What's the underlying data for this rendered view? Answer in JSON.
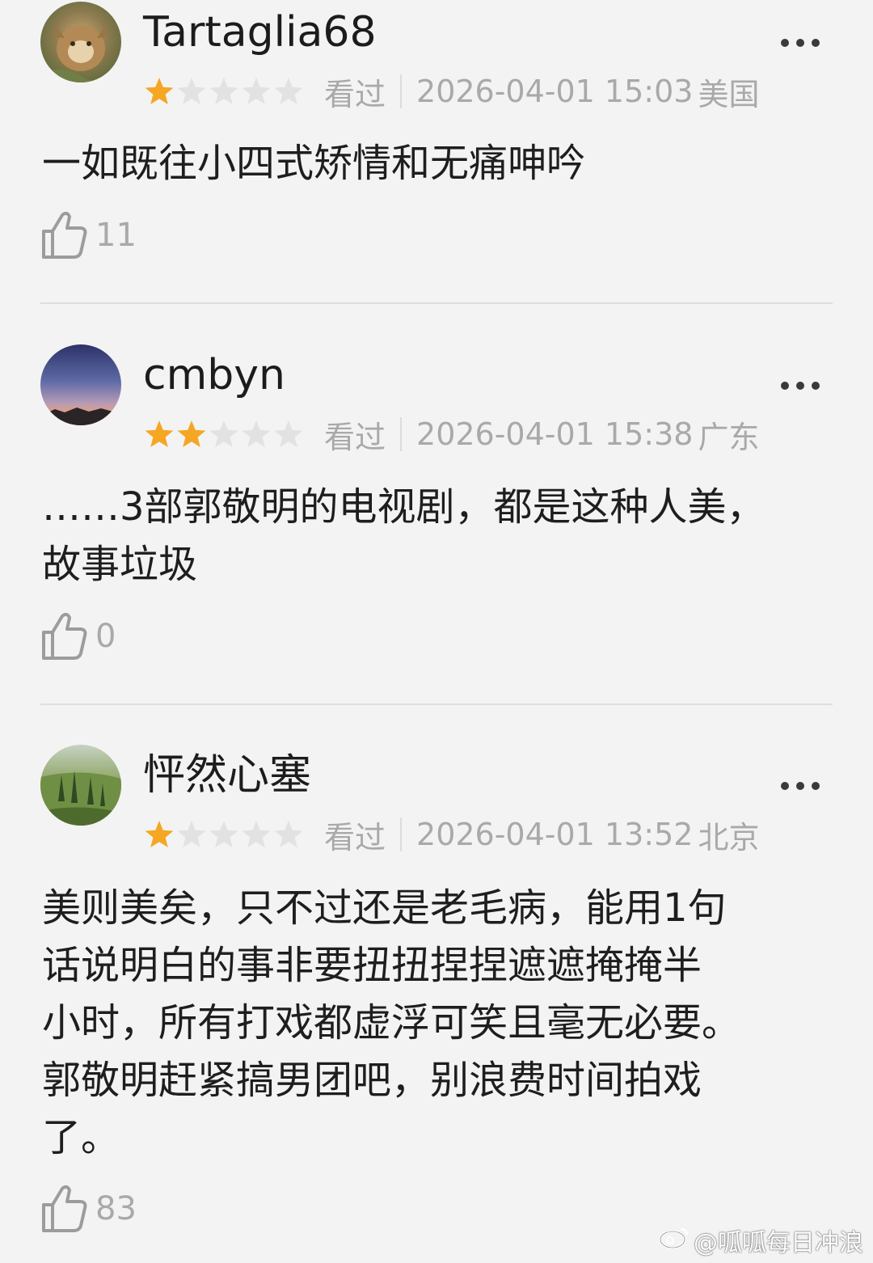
{
  "reviews": [
    {
      "username": "Tartaglia68",
      "rating": 1,
      "rating_max": 5,
      "status": "看过",
      "datetime": "2026-04-01 15:03",
      "location": "美国",
      "text": "一如既往小四式矫情和无痛呻吟",
      "likes": "11"
    },
    {
      "username": "cmbyn",
      "rating": 2,
      "rating_max": 5,
      "status": "看过",
      "datetime": "2026-04-01 15:38",
      "location": "广东",
      "text": "……3部郭敬明的电视剧，都是这种人美，\n故事垃圾",
      "likes": "0"
    },
    {
      "username": "怦然心塞",
      "rating": 1,
      "rating_max": 5,
      "status": "看过",
      "datetime": "2026-04-01 13:52",
      "location": "北京",
      "text": "美则美矣，只不过还是老毛病，能用1句\n话说明白的事非要扭扭捏捏遮遮掩掩半\n小时，所有打戏都虚浮可笑且毫无必要。\n郭敬明赶紧搞男团吧，别浪费时间拍戏\n了。",
      "likes": "83"
    }
  ],
  "watermark": "@呱呱每日冲浪",
  "colors": {
    "star_filled": "#f5a623",
    "star_empty": "#e2e2e2",
    "meta_text": "#a9a9a9",
    "background": "#f3f3f3"
  },
  "icons": {
    "like": "thumbs-up-icon",
    "more": "more-dots-icon",
    "watermark": "weibo-logo-icon"
  }
}
